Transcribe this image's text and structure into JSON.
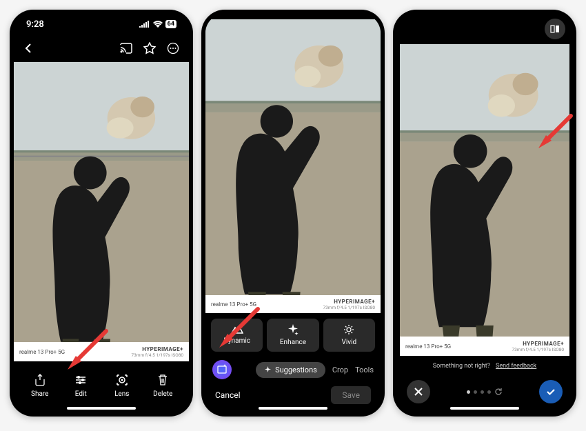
{
  "status": {
    "time": "9:28",
    "battery": "64"
  },
  "watermark": {
    "device": "realme 13 Pro+ 5G",
    "brand": "HYPERIMAGE+",
    "meta": "73mm  f/4.5  1/197s  ISO80"
  },
  "screen1": {
    "actions": {
      "share": "Share",
      "edit": "Edit",
      "lens": "Lens",
      "delete": "Delete"
    }
  },
  "screen2": {
    "filters": {
      "dynamic": "Dynamic",
      "enhance": "Enhance",
      "vivid": "Vivid"
    },
    "tabs": {
      "suggestions": "Suggestions",
      "crop": "Crop",
      "tools": "Tools"
    },
    "cancel": "Cancel",
    "save": "Save"
  },
  "screen3": {
    "feedback_q": "Something not right?",
    "feedback_link": "Send feedback"
  }
}
